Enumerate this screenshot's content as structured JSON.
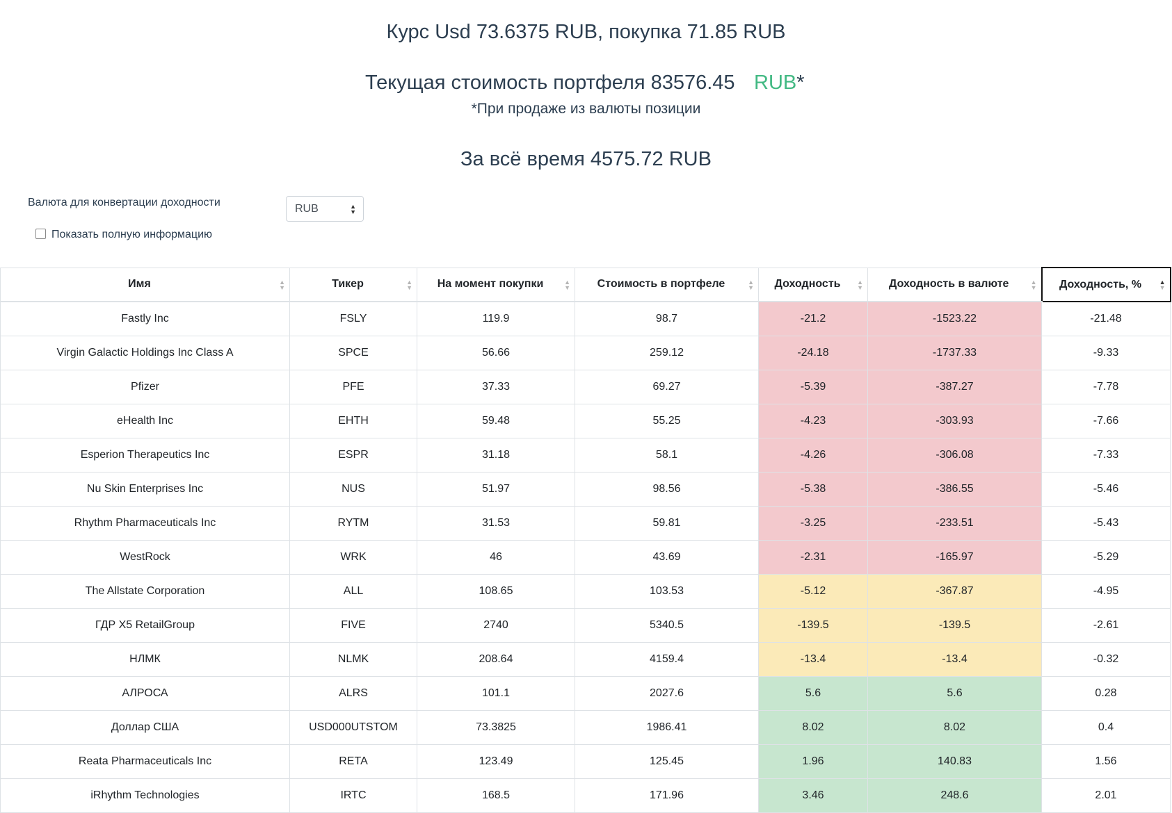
{
  "header": {
    "rate_text": "Курс Usd 73.6375 RUB, покупка 71.85 RUB",
    "portfolio_value_text": "Текущая стоимость портфеля 83576.45",
    "portfolio_currency": "RUB",
    "asterisk": "*",
    "note": "*При продаже из валюты позиции",
    "total_text": "За всё время 4575.72 RUB"
  },
  "controls": {
    "conversion_label": "Валюта для конвертации доходности",
    "conversion_value": "RUB",
    "show_full_label": "Показать полную информацию",
    "show_full_checked": false
  },
  "colors": {
    "accent_green": "#42b983",
    "loss_bg": "#f3c9cd",
    "neutral_bg": "#fbeab8",
    "gain_bg": "#c7e6cf"
  },
  "table": {
    "columns": [
      "Имя",
      "Тикер",
      "На момент покупки",
      "Стоимость в портфеле",
      "Доходность",
      "Доходность в валюте",
      "Доходность, %"
    ],
    "sorted_column": "Доходность, %",
    "rows": [
      {
        "name": "Fastly Inc",
        "ticker": "FSLY",
        "buy": "119.9",
        "value": "98.7",
        "yield": "-21.2",
        "yield_cur": "-1523.22",
        "yield_pct": "-21.48",
        "status": "loss"
      },
      {
        "name": "Virgin Galactic Holdings Inc Class A",
        "ticker": "SPCE",
        "buy": "56.66",
        "value": "259.12",
        "yield": "-24.18",
        "yield_cur": "-1737.33",
        "yield_pct": "-9.33",
        "status": "loss"
      },
      {
        "name": "Pfizer",
        "ticker": "PFE",
        "buy": "37.33",
        "value": "69.27",
        "yield": "-5.39",
        "yield_cur": "-387.27",
        "yield_pct": "-7.78",
        "status": "loss"
      },
      {
        "name": "eHealth Inc",
        "ticker": "EHTH",
        "buy": "59.48",
        "value": "55.25",
        "yield": "-4.23",
        "yield_cur": "-303.93",
        "yield_pct": "-7.66",
        "status": "loss"
      },
      {
        "name": "Esperion Therapeutics Inc",
        "ticker": "ESPR",
        "buy": "31.18",
        "value": "58.1",
        "yield": "-4.26",
        "yield_cur": "-306.08",
        "yield_pct": "-7.33",
        "status": "loss"
      },
      {
        "name": "Nu Skin Enterprises Inc",
        "ticker": "NUS",
        "buy": "51.97",
        "value": "98.56",
        "yield": "-5.38",
        "yield_cur": "-386.55",
        "yield_pct": "-5.46",
        "status": "loss"
      },
      {
        "name": "Rhythm Pharmaceuticals Inc",
        "ticker": "RYTM",
        "buy": "31.53",
        "value": "59.81",
        "yield": "-3.25",
        "yield_cur": "-233.51",
        "yield_pct": "-5.43",
        "status": "loss"
      },
      {
        "name": "WestRock",
        "ticker": "WRK",
        "buy": "46",
        "value": "43.69",
        "yield": "-2.31",
        "yield_cur": "-165.97",
        "yield_pct": "-5.29",
        "status": "loss"
      },
      {
        "name": "The Allstate Corporation",
        "ticker": "ALL",
        "buy": "108.65",
        "value": "103.53",
        "yield": "-5.12",
        "yield_cur": "-367.87",
        "yield_pct": "-4.95",
        "status": "neutral"
      },
      {
        "name": "ГДР X5 RetailGroup",
        "ticker": "FIVE",
        "buy": "2740",
        "value": "5340.5",
        "yield": "-139.5",
        "yield_cur": "-139.5",
        "yield_pct": "-2.61",
        "status": "neutral"
      },
      {
        "name": "НЛМК",
        "ticker": "NLMK",
        "buy": "208.64",
        "value": "4159.4",
        "yield": "-13.4",
        "yield_cur": "-13.4",
        "yield_pct": "-0.32",
        "status": "neutral"
      },
      {
        "name": "АЛРОСА",
        "ticker": "ALRS",
        "buy": "101.1",
        "value": "2027.6",
        "yield": "5.6",
        "yield_cur": "5.6",
        "yield_pct": "0.28",
        "status": "gain"
      },
      {
        "name": "Доллар США",
        "ticker": "USD000UTSTOM",
        "buy": "73.3825",
        "value": "1986.41",
        "yield": "8.02",
        "yield_cur": "8.02",
        "yield_pct": "0.4",
        "status": "gain"
      },
      {
        "name": "Reata Pharmaceuticals Inc",
        "ticker": "RETA",
        "buy": "123.49",
        "value": "125.45",
        "yield": "1.96",
        "yield_cur": "140.83",
        "yield_pct": "1.56",
        "status": "gain"
      },
      {
        "name": "iRhythm Technologies",
        "ticker": "IRTC",
        "buy": "168.5",
        "value": "171.96",
        "yield": "3.46",
        "yield_cur": "248.6",
        "yield_pct": "2.01",
        "status": "gain"
      }
    ]
  }
}
